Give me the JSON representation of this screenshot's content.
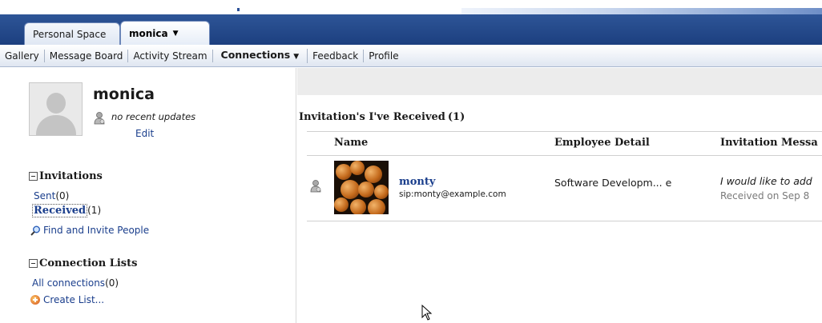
{
  "tabs": [
    {
      "label": "Personal Space",
      "active": false
    },
    {
      "label": "monica",
      "active": true,
      "has_dropdown": true
    }
  ],
  "nav": {
    "items": [
      "Gallery",
      "Message Board",
      "Activity Stream",
      "Connections",
      "Feedback",
      "Profile"
    ],
    "active": "Connections"
  },
  "profile": {
    "name": "monica",
    "status": "no recent updates",
    "edit_label": "Edit"
  },
  "invitations": {
    "title": "Invitations",
    "sent_label": "Sent",
    "sent_count": "(0)",
    "received_label": "Received",
    "received_count": "(1)",
    "find_label": "Find and Invite People"
  },
  "connection_lists": {
    "title": "Connection Lists",
    "all_label": "All connections",
    "all_count": "(0)",
    "create_label": "Create List..."
  },
  "main": {
    "title": "Invitation's I've Received",
    "title_count": "(1)",
    "columns": [
      "Name",
      "Employee Detail",
      "Invitation Messa"
    ],
    "rows": [
      {
        "name": "monty",
        "sip": "sip:monty@example.com",
        "employee_detail": "Software Developm... e",
        "message": "I would like to add",
        "received": "Received on Sep 8"
      }
    ]
  },
  "icons": [
    "presence-icon",
    "search-icon",
    "create-list-icon",
    "collapse-icon",
    "dropdown-caret-icon",
    "mouse-cursor-icon"
  ],
  "colors": {
    "brand_blue": "#1c3f7f",
    "link_blue": "#1a3e8c"
  }
}
